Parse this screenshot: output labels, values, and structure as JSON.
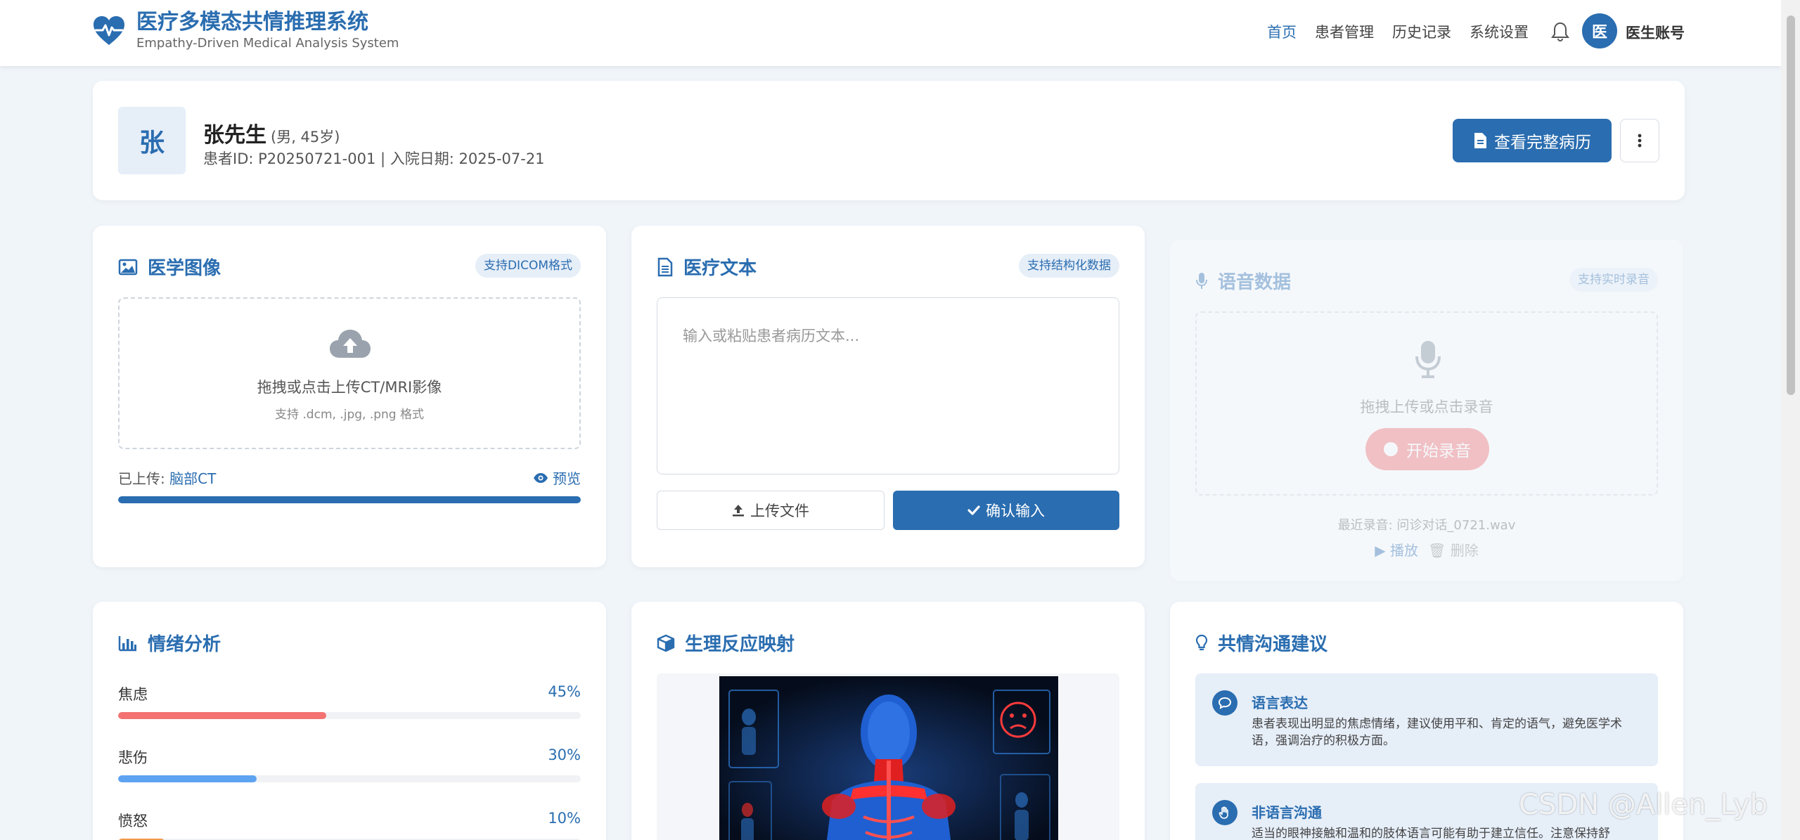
{
  "brand": {
    "title": "医疗多模态共情推理系统",
    "subtitle": "Empathy-Driven Medical Analysis System",
    "color": "#2a6db0"
  },
  "nav": {
    "items": [
      {
        "label": "首页",
        "active": true
      },
      {
        "label": "患者管理",
        "active": false
      },
      {
        "label": "历史记录",
        "active": false
      },
      {
        "label": "系统设置",
        "active": false
      }
    ],
    "avatar_text": "医",
    "user_label": "医生账号"
  },
  "patient": {
    "avatar_text": "张",
    "name": "张先生",
    "meta": "(男, 45岁)",
    "info": "患者ID: P20250721-001 | 入院日期: 2025-07-21",
    "view_record_button": "查看完整病历"
  },
  "image_module": {
    "title": "医学图像",
    "badge": "支持DICOM格式",
    "drop_text": "拖拽或点击上传CT/MRI影像",
    "drop_sub": "支持 .dcm, .jpg, .png 格式",
    "uploaded_prefix": "已上传:",
    "uploaded_name": "脑部CT",
    "preview_label": "预览",
    "progress": 100
  },
  "text_module": {
    "title": "医疗文本",
    "badge": "支持结构化数据",
    "placeholder": "输入或粘贴患者病历文本...",
    "upload_button": "上传文件",
    "confirm_button": "确认输入"
  },
  "voice_module": {
    "title": "语音数据",
    "badge": "支持实时录音",
    "drop_text": "拖拽上传或点击录音",
    "record_button": "开始录音",
    "recent": "最近录音: 问诊对话_0721.wav",
    "play_label": "播放",
    "delete_label": "删除"
  },
  "emotion_module": {
    "title": "情绪分析",
    "items": [
      {
        "label": "焦虑",
        "value_text": "45%",
        "value": 45,
        "color": "#f47272"
      },
      {
        "label": "悲伤",
        "value_text": "30%",
        "value": 30,
        "color": "#5ea3f2"
      },
      {
        "label": "愤怒",
        "value_text": "10%",
        "value": 10,
        "color": "#f2994a"
      }
    ]
  },
  "physio_module": {
    "title": "生理反应映射"
  },
  "empathy_module": {
    "title": "共情沟通建议",
    "items": [
      {
        "title": "语言表达",
        "text": "患者表现出明显的焦虑情绪，建议使用平和、肯定的语气，避免医学术语，强调治疗的积极方面。"
      },
      {
        "title": "非语言沟通",
        "text": "适当的眼神接触和温和的肢体语言可能有助于建立信任。注意保持舒"
      }
    ]
  },
  "watermark": "CSDN @Allen_Lyb"
}
